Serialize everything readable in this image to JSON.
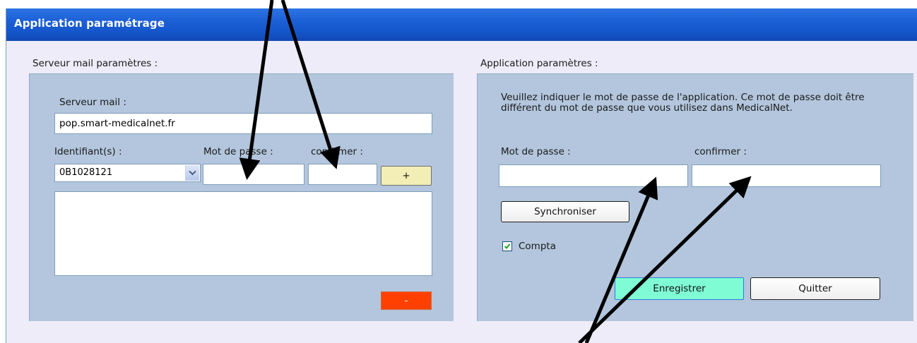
{
  "window": {
    "title": "Application paramétrage"
  },
  "mail": {
    "section_title": "Serveur mail paramètres :",
    "server_label": "Serveur mail :",
    "server_value": "pop.smart-medicalnet.fr",
    "id_label": "Identifiant(s) :",
    "password_label": "Mot de passe :",
    "confirm_label": "confirmer :",
    "id_selected": "0B1028121",
    "add_button": "+",
    "remove_button": "-",
    "accounts": []
  },
  "app": {
    "section_title": "Application paramètres :",
    "instruction": "Veuillez indiquer le mot de passe de l'application. Ce mot de passe doit être différent du mot de passe que vous utilisez dans MedicalNet.",
    "password_label": "Mot de passe :",
    "confirm_label": "confirmer :",
    "sync_button": "Synchroniser",
    "compta_label": "Compta",
    "compta_checked": true,
    "save_button": "Enregistrer",
    "quit_button": "Quitter"
  },
  "colors": {
    "titlebar": "#1c5fd6",
    "panel": "#b3c6dd",
    "window_bg": "#edecf8",
    "remove_button": "#ff4000",
    "save_button": "#7ffcd3",
    "add_button": "#f2eeb6"
  },
  "icons": {
    "combo_arrow": "chevron-down-icon",
    "checkbox_mark": "check-icon"
  }
}
